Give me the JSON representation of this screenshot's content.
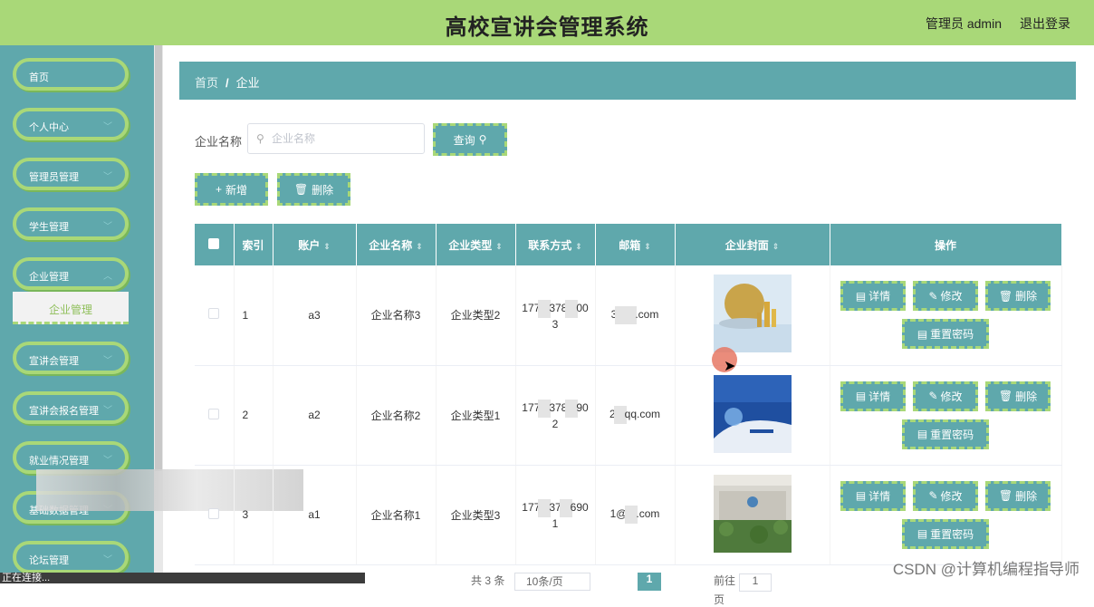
{
  "header": {
    "title": "高校宣讲会管理系统",
    "user": "管理员 admin",
    "logout": "退出登录"
  },
  "sidebar": {
    "items": [
      {
        "label": "首页",
        "has_arrow": false
      },
      {
        "label": "个人中心",
        "has_arrow": true
      },
      {
        "label": "管理员管理",
        "has_arrow": true
      },
      {
        "label": "学生管理",
        "has_arrow": true
      },
      {
        "label": "企业管理",
        "has_arrow": true
      },
      {
        "label": "宣讲会管理",
        "has_arrow": true
      },
      {
        "label": "宣讲会报名管理",
        "has_arrow": true
      },
      {
        "label": "就业情况管理",
        "has_arrow": true
      },
      {
        "label": "基础数据管理",
        "has_arrow": true
      },
      {
        "label": "论坛管理",
        "has_arrow": true
      }
    ],
    "active_sub": "企业管理"
  },
  "breadcrumb": {
    "home": "首页",
    "sep": "/",
    "current": "企业"
  },
  "search": {
    "label": "企业名称",
    "placeholder": "企业名称",
    "query_label": "查询"
  },
  "actions": {
    "add_label": "新增",
    "delete_label": "删除"
  },
  "table": {
    "headers": [
      "索引",
      "账户",
      "企业名称",
      "企业类型",
      "联系方式",
      "邮箱",
      "企业封面",
      "操作"
    ],
    "rows": [
      {
        "index": "1",
        "account": "a3",
        "name": "企业名称3",
        "type": "企业类型2",
        "phone_a": "177",
        "phone_b": "378",
        "phone_c": "00",
        "phone_d": "3",
        "email_a": "3",
        "email_b": ".com",
        "cover": "gold"
      },
      {
        "index": "2",
        "account": "a2",
        "name": "企业名称2",
        "type": "企业类型1",
        "phone_a": "177",
        "phone_b": "378",
        "phone_c": "90",
        "phone_d": "2",
        "email_a": "2",
        "email_b": "qq.com",
        "cover": "blue"
      },
      {
        "index": "3",
        "account": "a1",
        "name": "企业名称1",
        "type": "企业类型3",
        "phone_a": "177",
        "phone_b": "37",
        "phone_c": "690",
        "phone_d": "1",
        "email_a": "1@",
        "email_b": ".com",
        "cover": "wall"
      }
    ],
    "ops": {
      "detail": "详情",
      "edit": "修改",
      "delete": "删除",
      "reset": "重置密码"
    }
  },
  "pagination": {
    "total": "共 3 条",
    "sizes": "10条/页",
    "current": "1",
    "goto": "前往",
    "goto_val": "1",
    "page_unit": "页"
  },
  "status_bar": "正在连接...",
  "watermark": "CSDN @计算机编程指导师"
}
